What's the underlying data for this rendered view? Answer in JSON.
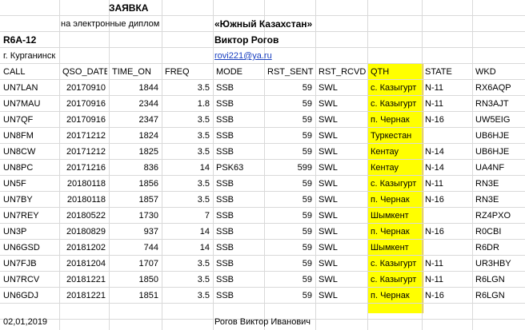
{
  "title": "ЗАЯВКА",
  "subtitle": "на электронные диплом",
  "award_name": "«Южный Казахстан»",
  "callsign": "R6A-12",
  "operator_name": "Виктор Рогов",
  "city": "г. Курганинск",
  "email": "rovi221@ya.ru",
  "columns": [
    "CALL",
    "QSO_DATE",
    "TIME_ON",
    "FREQ",
    "MODE",
    "RST_SENT",
    "RST_RCVD",
    "QTH",
    "STATE",
    "WKD"
  ],
  "rows": [
    {
      "call": "UN7LAN",
      "date": "20170910",
      "time": "1844",
      "freq": "3.5",
      "mode": "SSB",
      "rst_sent": "59",
      "rst_rcvd": "SWL",
      "qth": "с. Казыгурт",
      "state": "N-11",
      "wkd": "RX6AQP"
    },
    {
      "call": "UN7MAU",
      "date": "20170916",
      "time": "2344",
      "freq": "1.8",
      "mode": "SSB",
      "rst_sent": "59",
      "rst_rcvd": "SWL",
      "qth": "с. Казыгурт",
      "state": "N-11",
      "wkd": "RN3AJT"
    },
    {
      "call": "UN7QF",
      "date": "20170916",
      "time": "2347",
      "freq": "3.5",
      "mode": "SSB",
      "rst_sent": "59",
      "rst_rcvd": "SWL",
      "qth": "п. Чернак",
      "state": "N-16",
      "wkd": "UW5EIG"
    },
    {
      "call": "UN8FM",
      "date": "20171212",
      "time": "1824",
      "freq": "3.5",
      "mode": "SSB",
      "rst_sent": "59",
      "rst_rcvd": "SWL",
      "qth": "Туркестан",
      "state": "",
      "wkd": "UB6HJE"
    },
    {
      "call": "UN8CW",
      "date": "20171212",
      "time": "1825",
      "freq": "3.5",
      "mode": "SSB",
      "rst_sent": "59",
      "rst_rcvd": "SWL",
      "qth": "Кентау",
      "state": "N-14",
      "wkd": "UB6HJE"
    },
    {
      "call": "UN8PC",
      "date": "20171216",
      "time": "836",
      "freq": "14",
      "mode": "PSK63",
      "rst_sent": "599",
      "rst_rcvd": "SWL",
      "qth": "Кентау",
      "state": "N-14",
      "wkd": "UA4NF"
    },
    {
      "call": "UN5F",
      "date": "20180118",
      "time": "1856",
      "freq": "3.5",
      "mode": "SSB",
      "rst_sent": "59",
      "rst_rcvd": "SWL",
      "qth": "с. Казыгурт",
      "state": "N-11",
      "wkd": "RN3E"
    },
    {
      "call": "UN7BY",
      "date": "20180118",
      "time": "1857",
      "freq": "3.5",
      "mode": "SSB",
      "rst_sent": "59",
      "rst_rcvd": "SWL",
      "qth": "п. Чернак",
      "state": "N-16",
      "wkd": "RN3E"
    },
    {
      "call": "UN7REY",
      "date": "20180522",
      "time": "1730",
      "freq": "7",
      "mode": "SSB",
      "rst_sent": "59",
      "rst_rcvd": "SWL",
      "qth": "Шымкент",
      "state": "",
      "wkd": "RZ4PXO"
    },
    {
      "call": "UN3P",
      "date": "20180829",
      "time": "937",
      "freq": "14",
      "mode": "SSB",
      "rst_sent": "59",
      "rst_rcvd": "SWL",
      "qth": "п. Чернак",
      "state": "N-16",
      "wkd": "R0CBI"
    },
    {
      "call": "UN6GSD",
      "date": "20181202",
      "time": "744",
      "freq": "14",
      "mode": "SSB",
      "rst_sent": "59",
      "rst_rcvd": "SWL",
      "qth": "Шымкент",
      "state": "",
      "wkd": "R6DR"
    },
    {
      "call": "UN7FJB",
      "date": "20181204",
      "time": "1707",
      "freq": "3.5",
      "mode": "SSB",
      "rst_sent": "59",
      "rst_rcvd": "SWL",
      "qth": "с. Казыгурт",
      "state": "N-11",
      "wkd": "UR3HBY"
    },
    {
      "call": "UN7RCV",
      "date": "20181221",
      "time": "1850",
      "freq": "3.5",
      "mode": "SSB",
      "rst_sent": "59",
      "rst_rcvd": "SWL",
      "qth": "с. Казыгурт",
      "state": "N-11",
      "wkd": "R6LGN"
    },
    {
      "call": "UN6GDJ",
      "date": "20181221",
      "time": "1851",
      "freq": "3.5",
      "mode": "SSB",
      "rst_sent": "59",
      "rst_rcvd": "SWL",
      "qth": "п. Чернак",
      "state": "N-16",
      "wkd": "R6LGN"
    }
  ],
  "footer_date": "02,01,2019",
  "footer_signature": "Рогов Виктор Иванович"
}
